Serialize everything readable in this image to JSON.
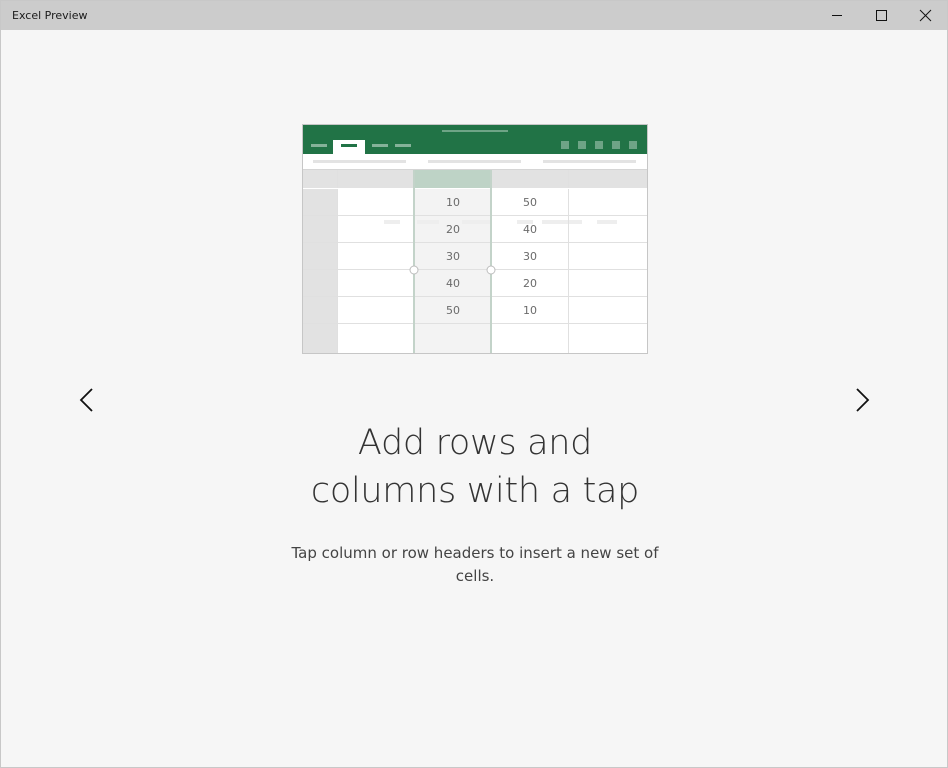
{
  "window": {
    "title": "Excel Preview",
    "controls": {
      "minimize_icon": "minimize-icon",
      "maximize_icon": "maximize-icon",
      "close_icon": "close-icon"
    }
  },
  "slide": {
    "heading_line1": "Add rows and",
    "heading_line2": "columns with a tap",
    "description": "Tap column or row headers to insert a new set of cells.",
    "prev_icon": "chevron-left-icon",
    "next_icon": "chevron-right-icon"
  },
  "illustration": {
    "brand_color": "#217346",
    "column_b": [
      "10",
      "20",
      "30",
      "40",
      "50"
    ],
    "column_c": [
      "50",
      "40",
      "30",
      "20",
      "10"
    ]
  }
}
